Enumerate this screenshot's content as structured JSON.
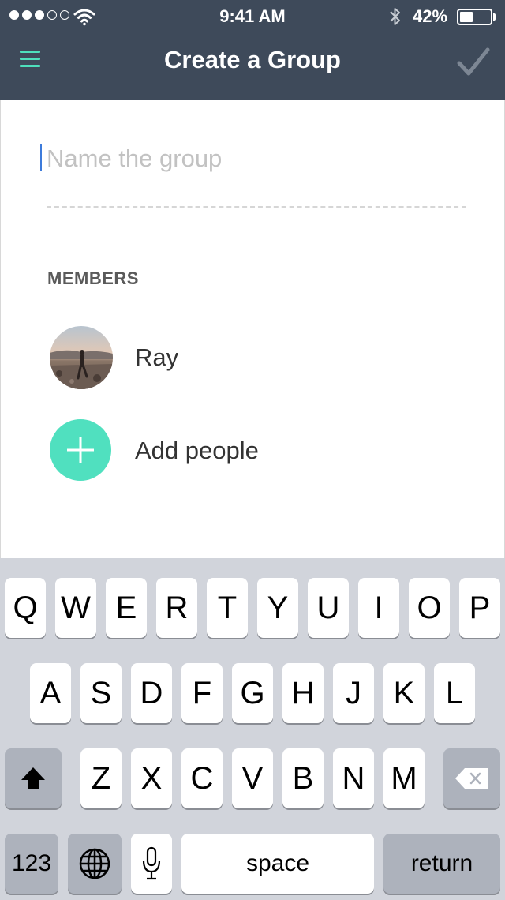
{
  "status_bar": {
    "time": "9:41 AM",
    "battery_percent": "42%",
    "signal_bars": 3,
    "signal_total": 5,
    "battery_level": 0.42
  },
  "header": {
    "title": "Create a Group",
    "menu_icon": "hamburger-menu-icon",
    "done_icon": "checkmark-icon"
  },
  "form": {
    "name_placeholder": "Name the group",
    "name_value": ""
  },
  "members": {
    "label": "MEMBERS",
    "items": [
      {
        "name": "Ray",
        "avatar": "photo-avatar"
      }
    ],
    "add_label": "Add people"
  },
  "keyboard": {
    "row1": [
      "Q",
      "W",
      "E",
      "R",
      "T",
      "Y",
      "U",
      "I",
      "O",
      "P"
    ],
    "row2": [
      "A",
      "S",
      "D",
      "F",
      "G",
      "H",
      "J",
      "K",
      "L"
    ],
    "row3": [
      "Z",
      "X",
      "C",
      "V",
      "B",
      "N",
      "M"
    ],
    "numbers_label": "123",
    "space_label": "space",
    "return_label": "return",
    "icons": [
      "shift-icon",
      "delete-icon",
      "globe-icon",
      "microphone-icon"
    ]
  },
  "colors": {
    "header_bg": "#3e4a5a",
    "accent": "#50e0bf",
    "keyboard_bg": "#d1d4db"
  }
}
